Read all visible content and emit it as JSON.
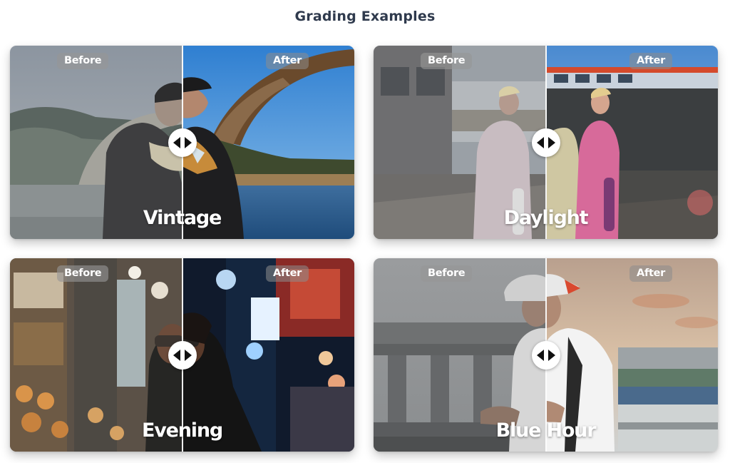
{
  "page": {
    "title": "Grading Examples"
  },
  "cards": [
    {
      "id": "vintage",
      "label": "Vintage",
      "before_label": "Before",
      "after_label": "After"
    },
    {
      "id": "daylight",
      "label": "Daylight",
      "before_label": "Before",
      "after_label": "After"
    },
    {
      "id": "evening",
      "label": "Evening",
      "before_label": "Before",
      "after_label": "After"
    },
    {
      "id": "blue-hour",
      "label": "Blue Hour",
      "before_label": "Before",
      "after_label": "After"
    }
  ],
  "icons": {
    "compare_handle": "left-right-arrows-icon"
  },
  "colors": {
    "title_text": "#2f3a4d",
    "pill_background": "#969696",
    "divider": "#ffffff"
  }
}
